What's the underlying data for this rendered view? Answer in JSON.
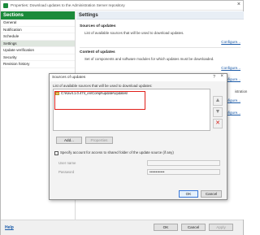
{
  "window": {
    "title": "Properties: Download updates to the Administration Server repository"
  },
  "sidebar": {
    "header": "Sections",
    "items": [
      {
        "label": "General"
      },
      {
        "label": "Notification"
      },
      {
        "label": "Schedule"
      },
      {
        "label": "Settings"
      },
      {
        "label": "Update verification"
      },
      {
        "label": "Security"
      },
      {
        "label": "Revision history"
      }
    ],
    "active": "Settings"
  },
  "pane": {
    "header": "Settings",
    "sections": [
      {
        "title": "Sources of updates",
        "desc": "List of available sources that will be used to download updates.",
        "link": "Configure..."
      },
      {
        "title": "Content of updates",
        "desc": "Set of components and software modules for which updates must be downloaded.",
        "link": "Configure..."
      }
    ],
    "partial_text": "istration",
    "partial_link_1": "Configure...",
    "partial_link_2": "Configure...",
    "partial_link_3": "Configure..."
  },
  "footer": {
    "help": "Help",
    "ok": "OK",
    "cancel": "Cancel",
    "apply": "Apply"
  },
  "dialog": {
    "title": "Sources of updates",
    "help_glyph": "?",
    "close_glyph": "×",
    "list_label": "List of available sources that will be used to download updates:",
    "source_item": "C:\\Kav4.1.0.474_en\\Compl\\update\\Updates\\",
    "add_label": "Add...",
    "properties_label": "Properties",
    "checkbox_label": "Specify account for access to shared folder of the update source (if any)",
    "checkbox_checked": false,
    "user_name_label": "User name",
    "password_label": "Password",
    "password_value": "••••••••••••",
    "ok_label": "OK",
    "cancel_label": "Cancel"
  },
  "colors": {
    "accent_green": "#1b8a3a",
    "link_blue": "#1a5aa8",
    "highlight_red": "#e0201a"
  }
}
